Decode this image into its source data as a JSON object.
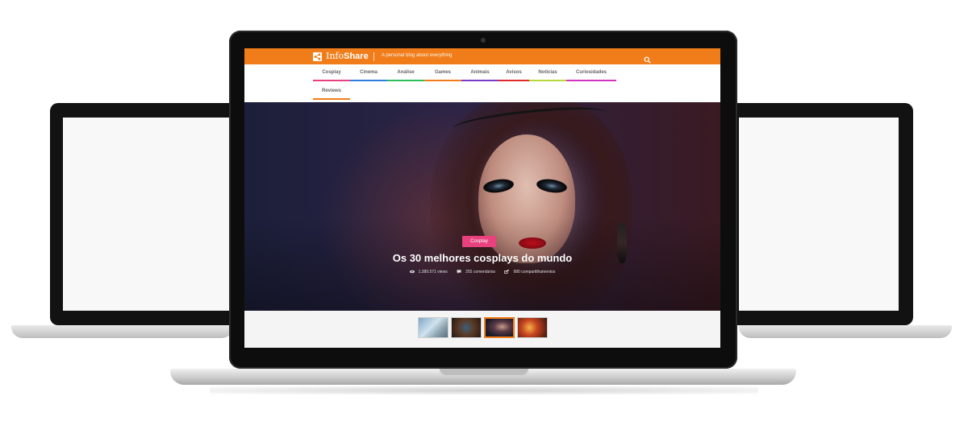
{
  "site": {
    "logo_light": "Info",
    "logo_bold": "Share",
    "tagline": "A personal blog about everything"
  },
  "nav": {
    "items": [
      {
        "label": "Cosplay",
        "color": "#e8417e"
      },
      {
        "label": "Cinema",
        "color": "#2d7fe0"
      },
      {
        "label": "Análise",
        "color": "#2fbf5a"
      },
      {
        "label": "Games",
        "color": "#f07d1a"
      },
      {
        "label": "Animais",
        "color": "#7c3cc8"
      },
      {
        "label": "Avisos",
        "color": "#e02a2a"
      },
      {
        "label": "Noticias",
        "color": "#b7d83a"
      },
      {
        "label": "Curiosidades",
        "color": "#d433c0"
      },
      {
        "label": "Reviews",
        "color": "#f07d1a"
      }
    ]
  },
  "hero": {
    "category": "Cosplay",
    "title": "Os 30 melhores cosplays do mundo",
    "views": "1.389.571 views",
    "comments": "255 comentários",
    "shares": "980 compartilhamentos"
  },
  "thumbnails": [
    {
      "name": "airship"
    },
    {
      "name": "phone-game"
    },
    {
      "name": "cosplay-face"
    },
    {
      "name": "fire-scene"
    }
  ],
  "colors": {
    "brand": "#f07d1a",
    "tag": "#e8417e"
  }
}
